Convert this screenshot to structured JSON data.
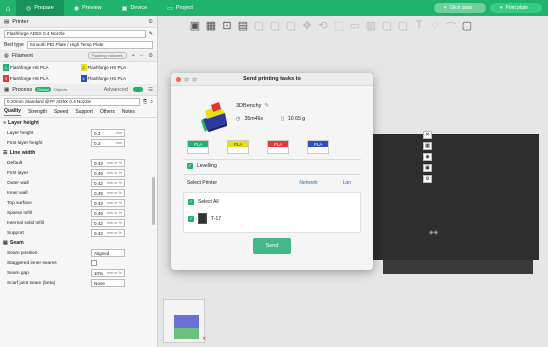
{
  "topbar": {
    "tabs": [
      {
        "label": "Prepare",
        "icon": "cube-icon"
      },
      {
        "label": "Preview",
        "icon": "eye-icon"
      },
      {
        "label": "Device",
        "icon": "device-icon"
      },
      {
        "label": "Project",
        "icon": "folder-icon"
      }
    ],
    "slice_label": "Slice plate",
    "print_label": "Print plate",
    "accent": "#1fb36e"
  },
  "printer": {
    "section": "Printer",
    "preset": "Flashforge AD5X 0.4 Nozzle",
    "bed_type_label": "Bed type",
    "bed_type_value": "Smooth PEI Plate / High Temp Plate"
  },
  "filament": {
    "section": "Filament",
    "flushing_label": "Flushing volumes",
    "slots": [
      {
        "num": "1",
        "color": "#1fb36e",
        "name": "Flashforge HS PLA"
      },
      {
        "num": "2",
        "color": "#e5e017",
        "name": "Flashforge HS PLA"
      },
      {
        "num": "3",
        "color": "#e23b3b",
        "name": "Flashforge HS PLA"
      },
      {
        "num": "4",
        "color": "#2f4fbf",
        "name": "Flashforge HS PLA"
      }
    ]
  },
  "process": {
    "section": "Process",
    "toggle_global": "Global",
    "toggle_objects": "Objects",
    "advanced_label": "Advanced",
    "preset": "0.20mm Standard @FF AD5X 0.4 Nozzle",
    "tabs": [
      "Quality",
      "Strength",
      "Speed",
      "Support",
      "Others",
      "Notes"
    ],
    "groups": [
      {
        "title": "Layer height",
        "rows": [
          {
            "label": "Layer height",
            "value": "0.2",
            "unit": "mm"
          },
          {
            "label": "First layer height",
            "value": "0.2",
            "unit": "mm"
          }
        ]
      },
      {
        "title": "Line width",
        "rows": [
          {
            "label": "Default",
            "value": "0.42",
            "unit": "mm or %"
          },
          {
            "label": "First layer",
            "value": "0.45",
            "unit": "mm or %"
          },
          {
            "label": "Outer wall",
            "value": "0.42",
            "unit": "mm or %"
          },
          {
            "label": "Inner wall",
            "value": "0.45",
            "unit": "mm or %"
          },
          {
            "label": "Top surface",
            "value": "0.42",
            "unit": "mm or %"
          },
          {
            "label": "Sparse infill",
            "value": "0.45",
            "unit": "mm or %"
          },
          {
            "label": "Internal solid infill",
            "value": "0.42",
            "unit": "mm or %"
          },
          {
            "label": "Support",
            "value": "0.42",
            "unit": "mm or %"
          }
        ]
      },
      {
        "title": "Seam",
        "rows": [
          {
            "label": "Seam position",
            "value": "Aligned",
            "unit": ""
          },
          {
            "label": "Staggered inner seams",
            "value": "",
            "unit": "",
            "checkbox": true
          },
          {
            "label": "Seam gap",
            "value": "10%",
            "unit": "mm or %"
          },
          {
            "label": "Scarf joint seam (beta)",
            "value": "None",
            "unit": ""
          }
        ]
      }
    ]
  },
  "dialog": {
    "title": "Send printing tasks to",
    "model_name": "3DBenchy",
    "time": "35m46s",
    "weight": "10.65 g",
    "filaments": [
      {
        "label": "PLA",
        "color": "#1fb36e"
      },
      {
        "label": "PLA",
        "color": "#e5e017"
      },
      {
        "label": "PLA",
        "color": "#e23b3b"
      },
      {
        "label": "PLA",
        "color": "#2f4fbf"
      }
    ],
    "leveling_label": "Levelling",
    "select_printer_label": "Select Printer",
    "network_label": "Network",
    "lan_label": "Lan",
    "select_all_label": "Select All",
    "printer_name": "T-17",
    "send_label": "Send"
  }
}
